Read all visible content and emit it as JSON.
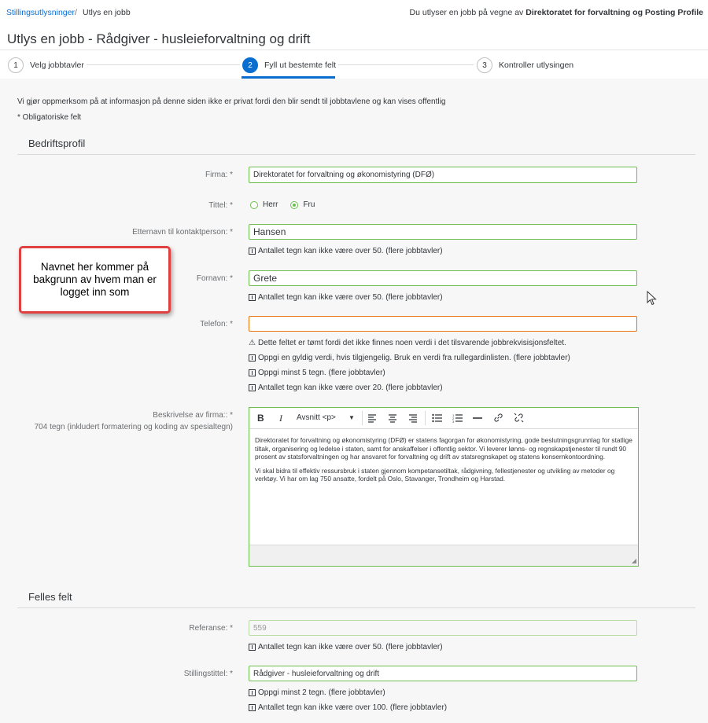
{
  "breadcrumb": {
    "parent": "Stillingsutlysninger",
    "separator": "/",
    "current": "Utlys en jobb"
  },
  "onbehalf": {
    "prefix": "Du utlyser en jobb på vegne av ",
    "org": "Direktoratet for forvaltning og Posting Profile"
  },
  "page_title": "Utlys en jobb - Rådgiver - husleieforvaltning og drift",
  "wizard": {
    "steps": [
      {
        "num": "1",
        "label": "Velg jobbtavler",
        "active": false
      },
      {
        "num": "2",
        "label": "Fyll ut bestemte felt",
        "active": true
      },
      {
        "num": "3",
        "label": "Kontroller utlysingen",
        "active": false
      }
    ]
  },
  "info": {
    "notice": "Vi gjør oppmerksom på at informasjon på denne siden ikke er privat fordi den blir sendt til jobbtavlene og kan vises offentlig",
    "required": "* Obligatoriske felt"
  },
  "section_company": "Bedriftsprofil",
  "fields": {
    "firma": {
      "label": "Firma: *",
      "value": "Direktoratet for forvaltning og økonomistyring (DFØ)"
    },
    "tittel": {
      "label": "Tittel: *",
      "options": [
        "Herr",
        "Fru"
      ],
      "selected": "Fru"
    },
    "etternavn": {
      "label": "Etternavn til kontaktperson: *",
      "value": "Hansen",
      "msg": "Antallet tegn kan ikke være over 50. (flere jobbtavler)"
    },
    "fornavn": {
      "label": "Fornavn: *",
      "value": "Grete",
      "msg": "Antallet tegn kan ikke være over 50. (flere jobbtavler)"
    },
    "telefon": {
      "label": "Telefon: *",
      "value": "",
      "warning": "Dette feltet er tømt fordi det ikke finnes noen verdi i det tilsvarende jobbrekvisisjonsfeltet.",
      "msgs": [
        "Oppgi en gyldig verdi, hvis tilgjengelig. Bruk en verdi fra rullegardinlisten. (flere jobbtavler)",
        "Oppgi minst 5 tegn. (flere jobbtavler)",
        "Antallet tegn kan ikke være over 20. (flere jobbtavler)"
      ]
    },
    "beskrivelse": {
      "label": "Beskrivelse av firma:: *",
      "count": "704 tegn (inkludert formatering og koding av spesialtegn)",
      "toolbar": {
        "bold": "B",
        "italic": "I",
        "format": "Avsnitt <p>"
      },
      "paragraphs": [
        "Direktoratet for forvaltning og økonomistyring (DFØ) er statens fagorgan for økonomistyring, gode beslutningsgrunnlag for statlige tiltak, organisering og ledelse i staten, samt for anskaffelser i offentlig sektor. Vi leverer lønns- og regnskapstjenester til rundt 90 prosent av statsforvaltningen og har ansvaret for forvaltning og drift av statsregnskapet og statens konsernkontoordning.",
        "Vi skal bidra til effektiv ressursbruk i staten gjennom kompetansetiltak, rådgivning, fellestjenester og utvikling av metoder og verktøy. Vi har om lag 750 ansatte, fordelt på Oslo, Stavanger, Trondheim og Harstad."
      ]
    }
  },
  "callout": "Navnet her kommer på bakgrunn av hvem man er logget inn som",
  "section_common": "Felles felt",
  "common": {
    "referanse": {
      "label": "Referanse: *",
      "value": "559",
      "msg": "Antallet tegn kan ikke være over 50. (flere jobbtavler)"
    },
    "stillingstittel": {
      "label": "Stillingstittel: *",
      "value": "Rådgiver - husleieforvaltning og drift",
      "msgs": [
        "Oppgi minst 2 tegn. (flere jobbtavler)",
        "Antallet tegn kan ikke være over 100. (flere jobbtavler)"
      ]
    }
  },
  "colors": {
    "accent": "#0a6ed1",
    "valid": "#6cbf4e",
    "warning": "#e9730c",
    "callout_border": "#e0403f"
  }
}
